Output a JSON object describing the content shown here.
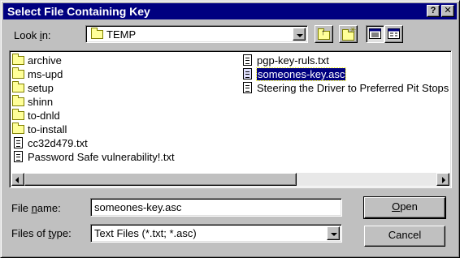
{
  "window": {
    "title": "Select File Containing Key",
    "help_glyph": "?",
    "close_glyph": "✕"
  },
  "look_in": {
    "label_pre": "Look ",
    "label_key": "i",
    "label_post": "n:",
    "value": "TEMP",
    "icon": "folder-icon"
  },
  "toolbar": {
    "up_icon": "up-one-level-icon",
    "new_folder_icon": "new-folder-icon",
    "list_view_icon": "list-view-icon",
    "details_view_icon": "details-view-icon"
  },
  "files": {
    "column1": [
      {
        "name": "archive",
        "type": "folder"
      },
      {
        "name": "ms-upd",
        "type": "folder"
      },
      {
        "name": "setup",
        "type": "folder"
      },
      {
        "name": "shinn",
        "type": "folder"
      },
      {
        "name": "to-dnld",
        "type": "folder"
      },
      {
        "name": "to-install",
        "type": "folder"
      },
      {
        "name": "cc32d479.txt",
        "type": "text"
      },
      {
        "name": "Password Safe vulnerability!.txt",
        "type": "text"
      }
    ],
    "column2": [
      {
        "name": "pgp-key-ruls.txt",
        "type": "text"
      },
      {
        "name": "someones-key.asc",
        "type": "asc",
        "selected": true
      },
      {
        "name": "Steering the Driver to Preferred Pit Stops",
        "type": "text"
      }
    ]
  },
  "file_name": {
    "label_pre": "File ",
    "label_key": "n",
    "label_post": "ame:",
    "value": "someones-key.asc"
  },
  "file_type": {
    "label_pre": "Files of ",
    "label_key": "t",
    "label_post": "ype:",
    "value": "Text Files (*.txt; *.asc)"
  },
  "buttons": {
    "open_key": "O",
    "open_rest": "pen",
    "cancel": "Cancel"
  },
  "colors": {
    "titlebar": "#000080",
    "face": "#c0c0c0",
    "selection": "#000080"
  }
}
